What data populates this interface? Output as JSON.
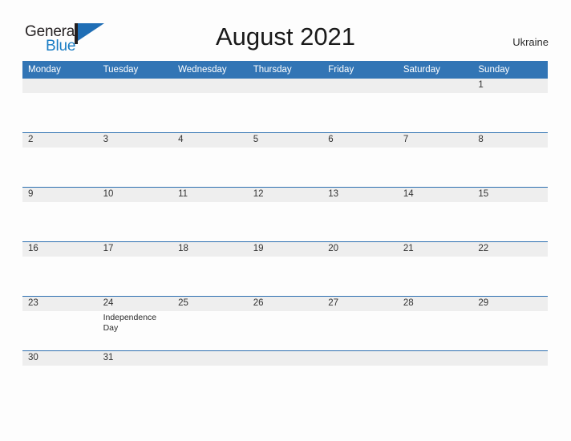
{
  "brand": {
    "name_part1": "General",
    "name_part2": "Blue",
    "flag_color": "#1f6eb5",
    "pole_color": "#231f20",
    "blue_text_color": "#1a7dc4"
  },
  "header": {
    "title": "August 2021",
    "country": "Ukraine"
  },
  "theme": {
    "header_blue": "#3275b5",
    "row_divider_blue": "#2d6fb0",
    "daynum_band_gray": "#eeeeee",
    "page_background": "#fdfdfd"
  },
  "calendar": {
    "month": "August",
    "year": "2021",
    "weekday_headers": [
      "Monday",
      "Tuesday",
      "Wednesday",
      "Thursday",
      "Friday",
      "Saturday",
      "Sunday"
    ],
    "weeks": [
      [
        {
          "day": "",
          "events": []
        },
        {
          "day": "",
          "events": []
        },
        {
          "day": "",
          "events": []
        },
        {
          "day": "",
          "events": []
        },
        {
          "day": "",
          "events": []
        },
        {
          "day": "",
          "events": []
        },
        {
          "day": "1",
          "events": []
        }
      ],
      [
        {
          "day": "2",
          "events": []
        },
        {
          "day": "3",
          "events": []
        },
        {
          "day": "4",
          "events": []
        },
        {
          "day": "5",
          "events": []
        },
        {
          "day": "6",
          "events": []
        },
        {
          "day": "7",
          "events": []
        },
        {
          "day": "8",
          "events": []
        }
      ],
      [
        {
          "day": "9",
          "events": []
        },
        {
          "day": "10",
          "events": []
        },
        {
          "day": "11",
          "events": []
        },
        {
          "day": "12",
          "events": []
        },
        {
          "day": "13",
          "events": []
        },
        {
          "day": "14",
          "events": []
        },
        {
          "day": "15",
          "events": []
        }
      ],
      [
        {
          "day": "16",
          "events": []
        },
        {
          "day": "17",
          "events": []
        },
        {
          "day": "18",
          "events": []
        },
        {
          "day": "19",
          "events": []
        },
        {
          "day": "20",
          "events": []
        },
        {
          "day": "21",
          "events": []
        },
        {
          "day": "22",
          "events": []
        }
      ],
      [
        {
          "day": "23",
          "events": []
        },
        {
          "day": "24",
          "events": [
            "Independence Day"
          ]
        },
        {
          "day": "25",
          "events": []
        },
        {
          "day": "26",
          "events": []
        },
        {
          "day": "27",
          "events": []
        },
        {
          "day": "28",
          "events": []
        },
        {
          "day": "29",
          "events": []
        }
      ],
      [
        {
          "day": "30",
          "events": []
        },
        {
          "day": "31",
          "events": []
        },
        {
          "day": "",
          "events": []
        },
        {
          "day": "",
          "events": []
        },
        {
          "day": "",
          "events": []
        },
        {
          "day": "",
          "events": []
        },
        {
          "day": "",
          "events": []
        }
      ]
    ]
  }
}
